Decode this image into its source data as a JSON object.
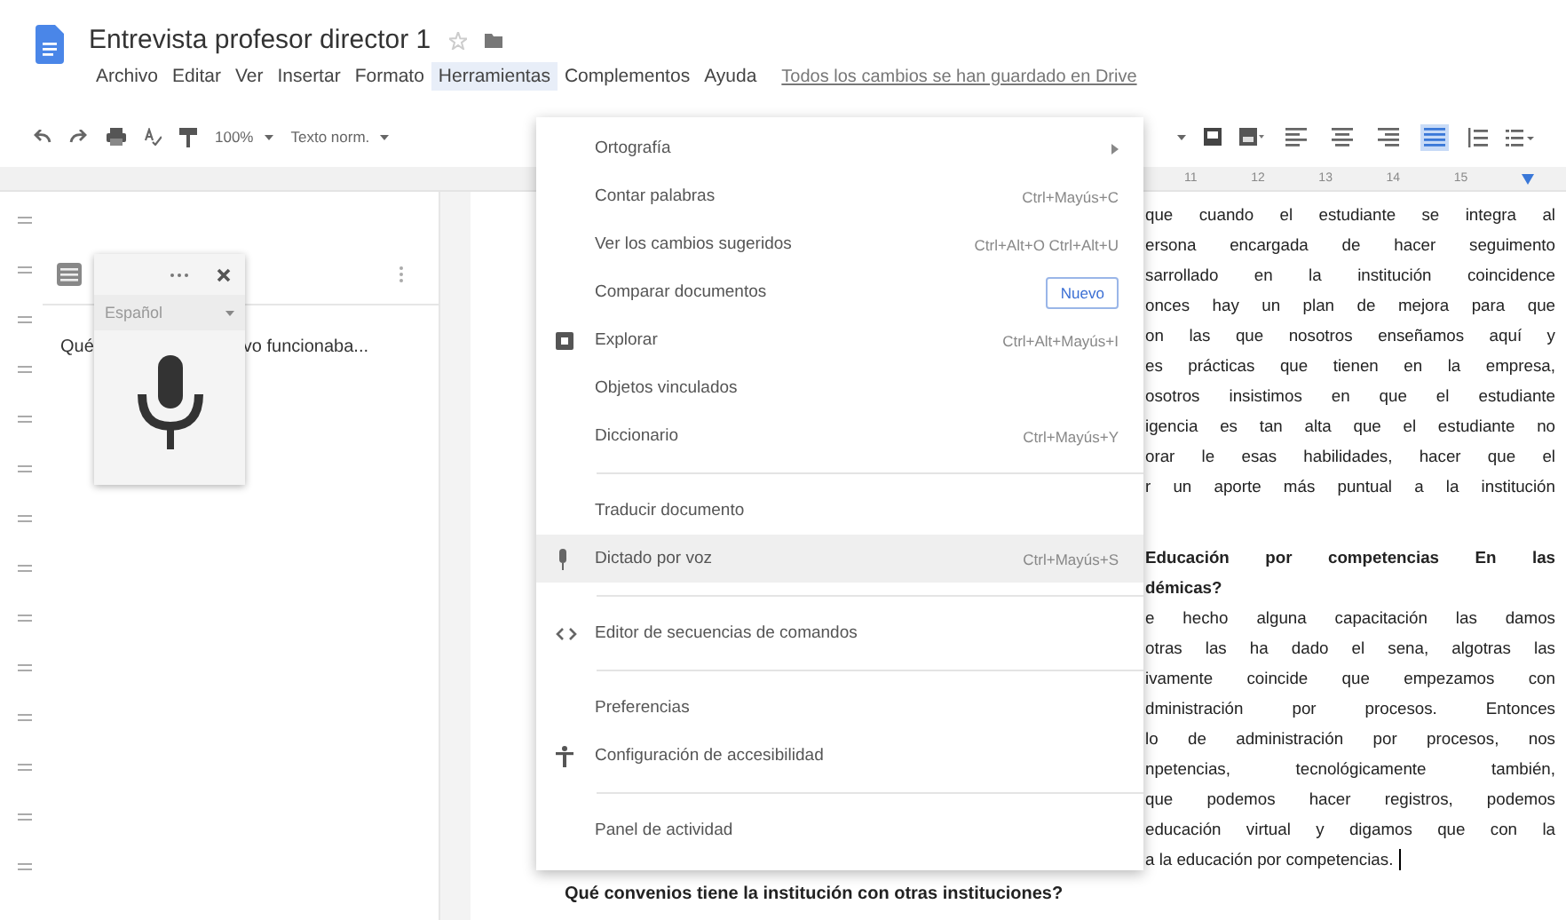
{
  "document_title": "Entrevista profesor director 1",
  "menu_bar": [
    {
      "label": "Archivo",
      "selected": false
    },
    {
      "label": "Editar",
      "selected": false
    },
    {
      "label": "Ver",
      "selected": false
    },
    {
      "label": "Insertar",
      "selected": false
    },
    {
      "label": "Formato",
      "selected": false
    },
    {
      "label": "Herramientas",
      "selected": true
    },
    {
      "label": "Complementos",
      "selected": false
    },
    {
      "label": "Ayuda",
      "selected": false
    }
  ],
  "save_status": "Todos los cambios se han guardado en Drive",
  "toolbar": {
    "zoom": "100%",
    "style": "Texto norm."
  },
  "alignment": [
    {
      "kind": "left",
      "selected": false
    },
    {
      "kind": "center",
      "selected": false
    },
    {
      "kind": "right",
      "selected": false
    },
    {
      "kind": "justify",
      "selected": true
    }
  ],
  "ruler_numbers": [
    "11",
    "12",
    "13",
    "14",
    "15"
  ],
  "outline": {
    "visible_parts": [
      "Qué",
      "vo funcionaba..."
    ]
  },
  "dictation": {
    "language": "Español"
  },
  "tools_menu": [
    {
      "kind": "plain",
      "label": "Ortografía",
      "submenu": true,
      "selected": false
    },
    {
      "kind": "plain",
      "label": "Contar palabras",
      "shortcut": "Ctrl+Mayús+C",
      "selected": false
    },
    {
      "kind": "plain",
      "label": "Ver los cambios sugeridos",
      "shortcut": "Ctrl+Alt+O Ctrl+Alt+U",
      "selected": false
    },
    {
      "kind": "plain",
      "label": "Comparar documentos",
      "badge": "Nuevo",
      "selected": false
    },
    {
      "kind": "explore",
      "label": "Explorar",
      "shortcut": "Ctrl+Alt+Mayús+I",
      "selected": false
    },
    {
      "kind": "plain",
      "label": "Objetos vinculados",
      "selected": false
    },
    {
      "kind": "plain",
      "label": "Diccionario",
      "shortcut": "Ctrl+Mayús+Y",
      "selected": false
    },
    {
      "kind": "divider"
    },
    {
      "kind": "plain",
      "label": "Traducir documento",
      "selected": false
    },
    {
      "kind": "voice",
      "label": "Dictado por voz",
      "shortcut": "Ctrl+Mayús+S",
      "selected": true
    },
    {
      "kind": "divider"
    },
    {
      "kind": "code",
      "label": "Editor de secuencias de comandos",
      "selected": false
    },
    {
      "kind": "divider"
    },
    {
      "kind": "plain",
      "label": "Preferencias",
      "selected": false
    },
    {
      "kind": "accessibility",
      "label": "Configuración de accesibilidad",
      "selected": false
    },
    {
      "kind": "divider"
    },
    {
      "kind": "plain",
      "label": "Panel de actividad",
      "selected": false
    }
  ],
  "document": {
    "paragraphs": [
      {
        "bold": false,
        "cursor": false,
        "lines": [
          "que cuando el estudiante se integra al",
          "ersona encargada de hacer seguimento",
          "sarrollado en la institución coincidence",
          "onces hay un plan de mejora para que",
          "on las que nosotros enseñamos aquí y",
          "es prácticas que tienen en la empresa,",
          "osotros insistimos en que el estudiante",
          "igencia es tan alta que el estudiante no",
          "orar le esas habilidades, hacer que el",
          "r un aporte más puntual a la institución"
        ]
      },
      {
        "bold": true,
        "cursor": false,
        "lines": [
          "Educación por competencias En las",
          "démicas?"
        ]
      },
      {
        "bold": false,
        "cursor": true,
        "lines": [
          "e hecho alguna capacitación las damos",
          "otras las ha dado el sena, algotras las",
          "ivamente coincide que empezamos con",
          "dministración por procesos. Entonces",
          "lo de administración por procesos, nos",
          "npetencias, tecnológicamente también,",
          "que podemos hacer registros, podemos",
          "educación virtual y digamos que con la",
          "a la educación por competencias."
        ]
      }
    ],
    "question": "Qué convenios tiene la institución con otras instituciones?"
  }
}
